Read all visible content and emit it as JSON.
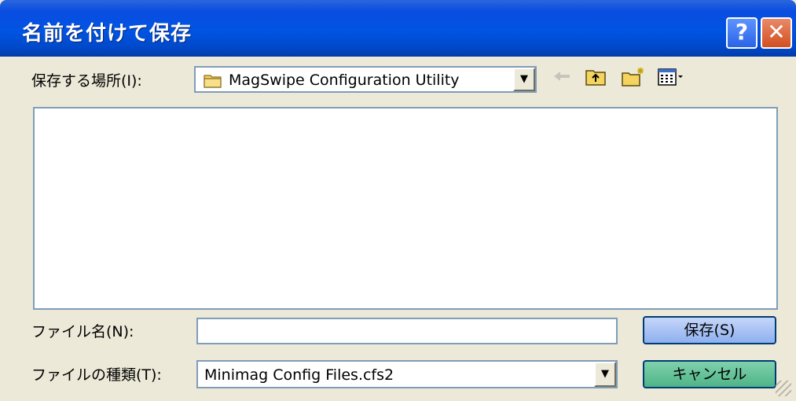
{
  "window": {
    "title": "名前を付けて保存",
    "help_label": "?",
    "close_label": "✕"
  },
  "location": {
    "label": "保存する場所(I):",
    "value": "MagSwipe Configuration Utility",
    "folder_icon": "folder-icon"
  },
  "toolbar": {
    "back_icon": "back-arrow-icon",
    "up_icon": "up-folder-icon",
    "new_folder_icon": "new-folder-icon",
    "view_menu_icon": "view-menu-icon"
  },
  "file_list": {
    "items": []
  },
  "filename": {
    "label": "ファイル名(N):",
    "value": ""
  },
  "filetype": {
    "label": "ファイルの種類(T):",
    "value": "Minimag Config Files.cfs2"
  },
  "buttons": {
    "save": "保存(S)",
    "cancel": "キャンセル"
  },
  "colors": {
    "titlebar": "#0054e3",
    "dialog_bg": "#ece9d8",
    "field_border": "#7f9db9"
  }
}
